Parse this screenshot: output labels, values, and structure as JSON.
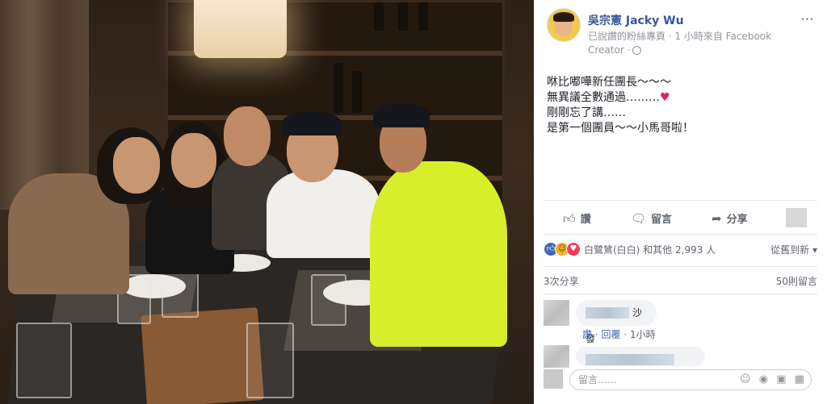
{
  "post": {
    "page_name": "吳宗憲 Jacky Wu",
    "meta": "已說讚的粉絲專頁 · 1 小時來自 Facebook Creator ·",
    "lines": [
      "咻比嘟嘩新任團長～～～",
      "無異議全數通過………",
      "剛剛忘了講……",
      "是第一個團員～～小馬哥啦！"
    ],
    "heart": "♥"
  },
  "actions": {
    "like": "讚",
    "comment": "留言",
    "share": "分享"
  },
  "reactions": {
    "summary": "白鷺鷥(白白) 和其他 2,993 人",
    "sort": "從舊到新 ▾"
  },
  "counts": {
    "shares": "3次分享",
    "comments": "50則留言"
  },
  "comments": [
    {
      "text": "沙發",
      "actions": {
        "like": "讚",
        "reply": "回覆",
        "time": "1小時"
      }
    }
  ],
  "input": {
    "placeholder": "留言……",
    "icons": [
      "emoji-icon",
      "camera-icon",
      "gif-icon",
      "sticker-icon"
    ]
  },
  "colors": {
    "link": "#365899",
    "meta": "#90949c",
    "text": "#1d2129",
    "like_blue": "#4267b2",
    "heart": "#e0245e"
  }
}
